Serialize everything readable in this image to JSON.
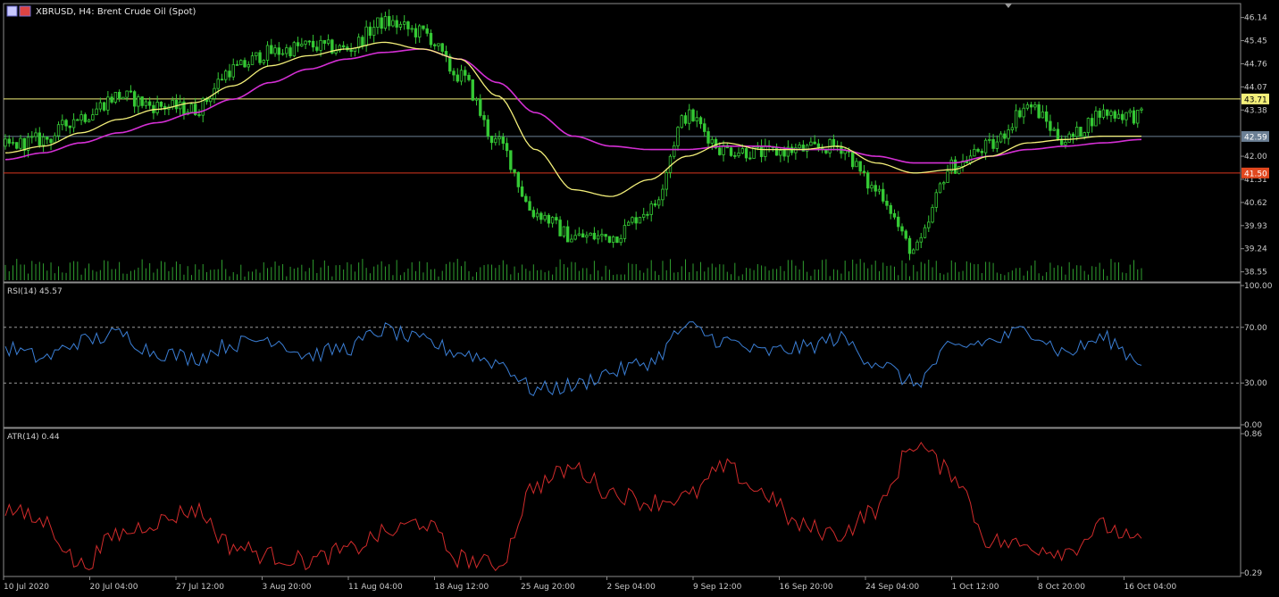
{
  "header": {
    "title": "XBRUSD, H4:  Brent Crude Oil (Spot)"
  },
  "colors": {
    "background": "#000000",
    "grid_border": "#8c8c8c",
    "bull_candle": "#35c935",
    "bear_candle": "#35c935",
    "volume": "#2f9e2f",
    "ma_fast": "#f4f07a",
    "ma_slow": "#d42fd4",
    "rsi_line": "#3b7fd6",
    "atr_line": "#d12b2b",
    "level_upper": "#f4f07a",
    "level_mid": "#6b7f94",
    "level_lower": "#d9361f",
    "tag_upper_bg": "#f4f07a",
    "tag_mid_bg": "#6b7f94",
    "tag_lower_bg": "#e2481f"
  },
  "price_panel": {
    "price_ticks": [
      "46.14",
      "45.45",
      "44.76",
      "44.07",
      "43.38",
      "42.00",
      "41.31",
      "40.62",
      "39.93",
      "39.24",
      "38.55"
    ],
    "ylim": [
      38.3,
      46.45
    ],
    "levels": [
      {
        "name": "upper",
        "value": 43.71,
        "label": "43.71"
      },
      {
        "name": "mid",
        "value": 42.59,
        "label": "42.59"
      },
      {
        "name": "lower",
        "value": 41.5,
        "label": "41.50"
      }
    ]
  },
  "rsi_panel": {
    "label": "RSI(14) 45.57",
    "ticks": [
      "100.00",
      "70.00",
      "30.00",
      "0.00"
    ],
    "ylim": [
      0,
      100
    ],
    "levels": [
      70,
      30
    ]
  },
  "atr_panel": {
    "label": "ATR(14) 0.44",
    "ticks": [
      "0.86",
      "0.29"
    ],
    "ylim": [
      0.29,
      0.86
    ]
  },
  "time_axis": {
    "labels": [
      "10 Jul 2020",
      "20 Jul 04:00",
      "27 Jul 12:00",
      "3 Aug 20:00",
      "11 Aug 04:00",
      "18 Aug 12:00",
      "25 Aug 20:00",
      "2 Sep 04:00",
      "9 Sep 12:00",
      "16 Sep 20:00",
      "24 Sep 04:00",
      "1 Oct 12:00",
      "8 Oct 20:00",
      "16 Oct 04:00"
    ]
  },
  "chart_data": {
    "type": "line",
    "title": "XBRUSD, H4:  Brent Crude Oil (Spot)",
    "x_labels": [
      "10 Jul 2020",
      "20 Jul 04:00",
      "27 Jul 12:00",
      "3 Aug 20:00",
      "11 Aug 04:00",
      "18 Aug 12:00",
      "25 Aug 20:00",
      "2 Sep 04:00",
      "9 Sep 12:00",
      "16 Sep 20:00",
      "24 Sep 04:00",
      "1 Oct 12:00",
      "8 Oct 20:00",
      "16 Oct 04:00"
    ],
    "price_anchors": [
      42.3,
      42.5,
      43.2,
      43.8,
      43.5,
      43.4,
      44.6,
      45.1,
      45.3,
      45.2,
      46.0,
      45.7,
      44.4,
      42.4,
      40.3,
      39.6,
      39.6,
      40.4,
      43.2,
      42.2,
      42.1,
      42.2,
      42.3,
      41.0,
      39.2,
      41.7,
      42.3,
      43.5,
      42.5,
      43.3,
      43.2
    ],
    "ma_fast_anchors": [
      42.1,
      42.3,
      42.7,
      43.1,
      43.4,
      43.6,
      44.1,
      44.7,
      45.0,
      45.2,
      45.4,
      45.2,
      44.9,
      43.8,
      42.2,
      41.0,
      40.8,
      41.3,
      42.0,
      42.4,
      42.2,
      42.2,
      42.3,
      41.8,
      41.5,
      41.6,
      42.0,
      42.4,
      42.5,
      42.6,
      42.6
    ],
    "ma_slow_anchors": [
      41.9,
      42.1,
      42.4,
      42.7,
      43.0,
      43.3,
      43.7,
      44.2,
      44.6,
      44.9,
      45.1,
      45.2,
      44.9,
      44.2,
      43.3,
      42.6,
      42.3,
      42.2,
      42.2,
      42.3,
      42.3,
      42.2,
      42.2,
      42.0,
      41.8,
      41.8,
      42.0,
      42.2,
      42.3,
      42.4,
      42.5
    ],
    "rsi_anchors": [
      55,
      48,
      60,
      65,
      52,
      48,
      58,
      62,
      50,
      55,
      68,
      60,
      52,
      45,
      25,
      28,
      38,
      45,
      70,
      60,
      52,
      55,
      62,
      45,
      30,
      55,
      60,
      68,
      52,
      62,
      46
    ],
    "atr_anchors": [
      0.55,
      0.5,
      0.32,
      0.45,
      0.5,
      0.55,
      0.4,
      0.36,
      0.34,
      0.38,
      0.45,
      0.5,
      0.35,
      0.32,
      0.65,
      0.72,
      0.62,
      0.58,
      0.6,
      0.72,
      0.62,
      0.48,
      0.45,
      0.55,
      0.82,
      0.7,
      0.42,
      0.4,
      0.38,
      0.48,
      0.41
    ],
    "rsi_ylim": [
      0,
      100
    ],
    "atr_ylim": [
      0.29,
      0.86
    ]
  }
}
